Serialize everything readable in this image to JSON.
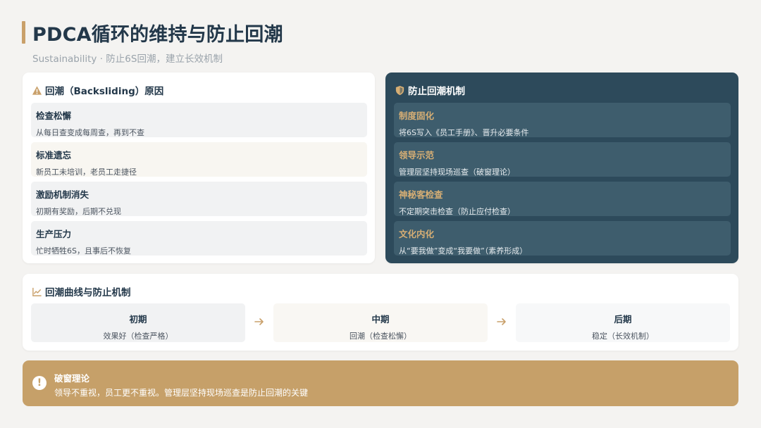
{
  "page": {
    "title": "PDCA循环的维持与防止回潮",
    "subtitle": "Sustainability · 防止6S回潮，建立长效机制"
  },
  "colors": {
    "accent": "#c9a06a",
    "navy": "#2d4a5b",
    "gold_text": "#d6ae74",
    "alert_bg": "#c6a069"
  },
  "causes": {
    "icon": "warning-triangle-icon",
    "heading": "回潮（Backsliding）原因",
    "items": [
      {
        "title": "检查松懈",
        "desc": "从每日查变成每周查，再到不查"
      },
      {
        "title": "标准遗忘",
        "desc": "新员工未培训，老员工走捷径"
      },
      {
        "title": "激励机制消失",
        "desc": "初期有奖励，后期不兑现"
      },
      {
        "title": "生产压力",
        "desc": "忙时牺牲6S，且事后不恢复"
      }
    ]
  },
  "mechanisms": {
    "icon": "shield-icon",
    "heading": "防止回潮机制",
    "items": [
      {
        "title": "制度固化",
        "desc": "将6S写入《员工手册》、晋升必要条件"
      },
      {
        "title": "领导示范",
        "desc": "管理层坚持现场巡查（破窗理论）"
      },
      {
        "title": "神秘客检查",
        "desc": "不定期突击检查（防止应付检查）"
      },
      {
        "title": "文化内化",
        "desc": "从“要我做”变成“我要做”（素养形成）"
      }
    ]
  },
  "curve": {
    "icon": "line-chart-icon",
    "heading": "回潮曲线与防止机制",
    "phases": [
      {
        "title": "初期",
        "desc": "效果好（检查严格）"
      },
      {
        "title": "中期",
        "desc": "回潮（检查松懈）"
      },
      {
        "title": "后期",
        "desc": "稳定（长效机制）"
      }
    ]
  },
  "alert": {
    "icon": "exclamation-icon",
    "title": "破窗理论",
    "desc": "领导不重视，员工更不重视。管理层坚持现场巡查是防止回潮的关键"
  }
}
